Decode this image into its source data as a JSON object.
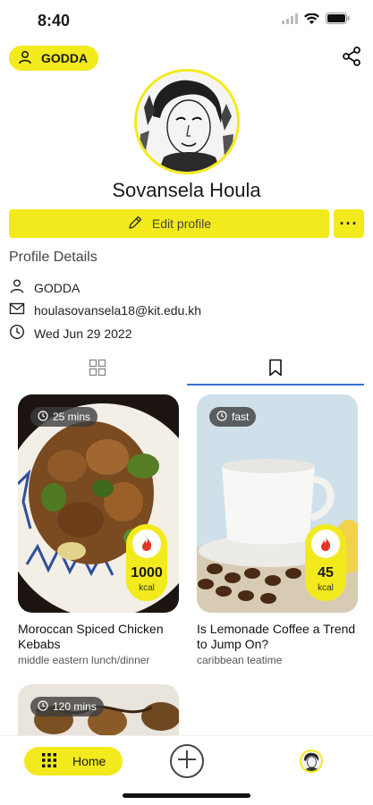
{
  "status_bar": {
    "time": "8:40"
  },
  "header": {
    "username_chip": "GODDA"
  },
  "profile": {
    "name": "Sovansela Houla",
    "edit_label": "Edit profile",
    "more_label": "···"
  },
  "details": {
    "title": "Profile Details",
    "username": "GODDA",
    "email": "houlasovansela18@kit.edu.kh",
    "date": "Wed Jun 29 2022"
  },
  "recipes": [
    {
      "time": "25 mins",
      "kcal": "1000",
      "unit": "kcal",
      "title": "Moroccan Spiced Chicken Kebabs",
      "category": "middle eastern lunch/dinner"
    },
    {
      "time": "fast",
      "kcal": "45",
      "unit": "kcal",
      "title": "Is Lemonade Coffee a Trend to Jump On?",
      "category": "caribbean teatime"
    },
    {
      "time": "120 mins"
    }
  ],
  "bottom_nav": {
    "home_label": "Home"
  },
  "colors": {
    "accent": "#f2ea1c",
    "tab_indicator": "#3a6fd8"
  }
}
